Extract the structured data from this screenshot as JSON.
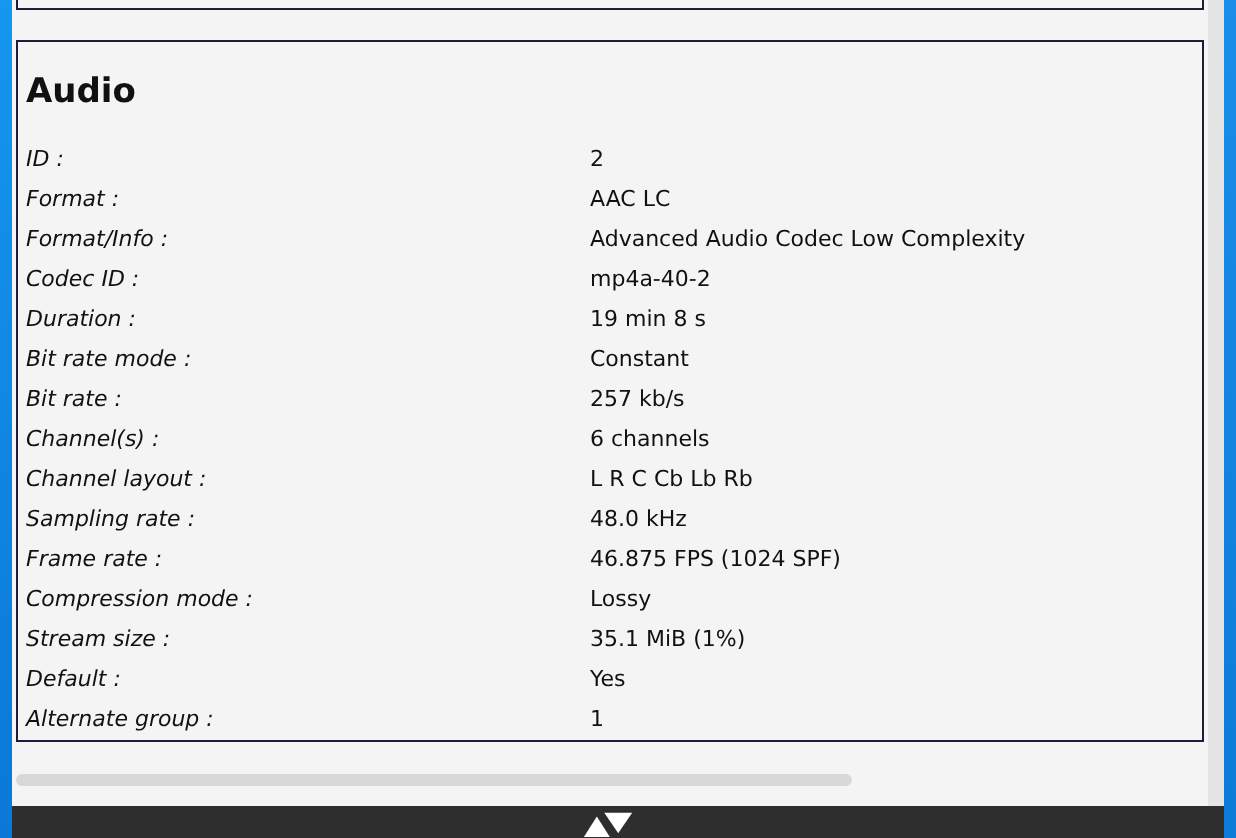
{
  "section": {
    "title": "Audio",
    "rows": [
      {
        "label": "ID :",
        "value": "2"
      },
      {
        "label": "Format :",
        "value": "AAC LC"
      },
      {
        "label": "Format/Info :",
        "value": "Advanced Audio Codec Low Complexity"
      },
      {
        "label": "Codec ID :",
        "value": "mp4a-40-2"
      },
      {
        "label": "Duration :",
        "value": "19 min 8 s"
      },
      {
        "label": "Bit rate mode :",
        "value": "Constant"
      },
      {
        "label": "Bit rate :",
        "value": "257 kb/s"
      },
      {
        "label": "Channel(s) :",
        "value": "6 channels"
      },
      {
        "label": "Channel layout :",
        "value": "L R C Cb Lb Rb"
      },
      {
        "label": "Sampling rate :",
        "value": "48.0 kHz"
      },
      {
        "label": "Frame rate :",
        "value": "46.875 FPS (1024 SPF)"
      },
      {
        "label": "Compression mode :",
        "value": "Lossy"
      },
      {
        "label": "Stream size :",
        "value": "35.1 MiB (1%)"
      },
      {
        "label": "Default :",
        "value": "Yes"
      },
      {
        "label": "Alternate group :",
        "value": "1"
      }
    ]
  }
}
